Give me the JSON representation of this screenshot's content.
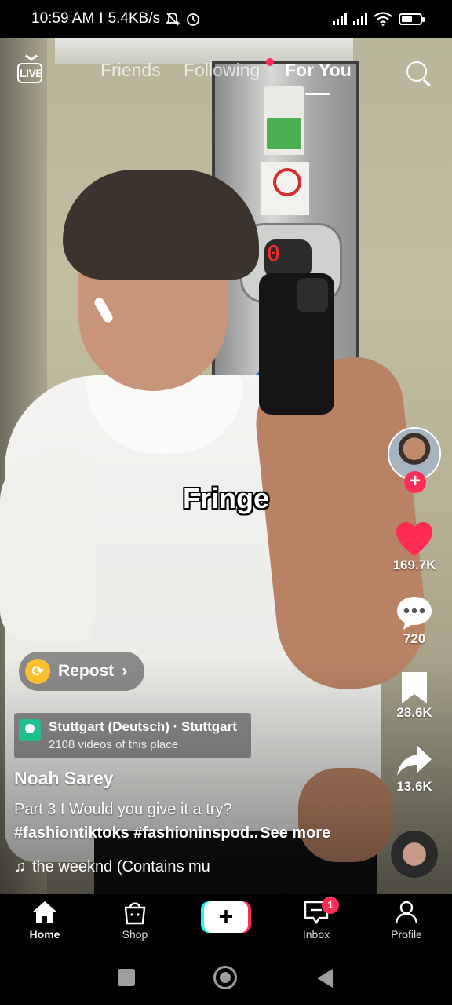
{
  "status_bar": {
    "time": "10:59 AM",
    "net_speed": "5.4KB/s",
    "icons": [
      "muted-bell-icon",
      "alarm-icon",
      "signal-icon",
      "signal-icon",
      "wifi-icon",
      "battery-icon"
    ],
    "battery_level": 0.6
  },
  "video": {
    "elevator_floor": "0",
    "overlay_text": "Fringe"
  },
  "top_nav": {
    "live_label": "LIVE",
    "tabs": [
      {
        "label": "Friends",
        "active": false
      },
      {
        "label": "Following",
        "active": false,
        "has_dot": true
      },
      {
        "label": "For You",
        "active": true
      }
    ],
    "search_icon": "search-icon"
  },
  "actions": {
    "follow_plus": "+",
    "likes": "169.7K",
    "comments": "720",
    "saves": "28.6K",
    "shares": "13.6K"
  },
  "repost": {
    "label": "Repost",
    "chevron": "›"
  },
  "location": {
    "name": "Stuttgart (Deutsch) · Stuttgart",
    "sub": "2108 videos of this place"
  },
  "post": {
    "author": "Noah Sarey",
    "caption_line1": "Part 3 I Would you give it a try?",
    "hashtags": "#fashiontiktoks #fashioninspod..",
    "see_more": "See more",
    "music_note": "♫",
    "music": "the weeknd (Contains mu"
  },
  "tab_bar": {
    "items": [
      {
        "label": "Home",
        "icon": "home-icon",
        "active": true
      },
      {
        "label": "Shop",
        "icon": "shop-bag-icon",
        "active": false
      },
      {
        "label": "Inbox",
        "icon": "inbox-icon",
        "active": false,
        "badge": "1"
      },
      {
        "label": "Profile",
        "icon": "profile-icon",
        "active": false
      }
    ],
    "create_label": "+"
  },
  "colors": {
    "accent_red": "#fe2c55",
    "accent_cyan": "#25f4ee",
    "repost_yellow": "#fbc02d",
    "location_green": "#1fbf8f"
  }
}
